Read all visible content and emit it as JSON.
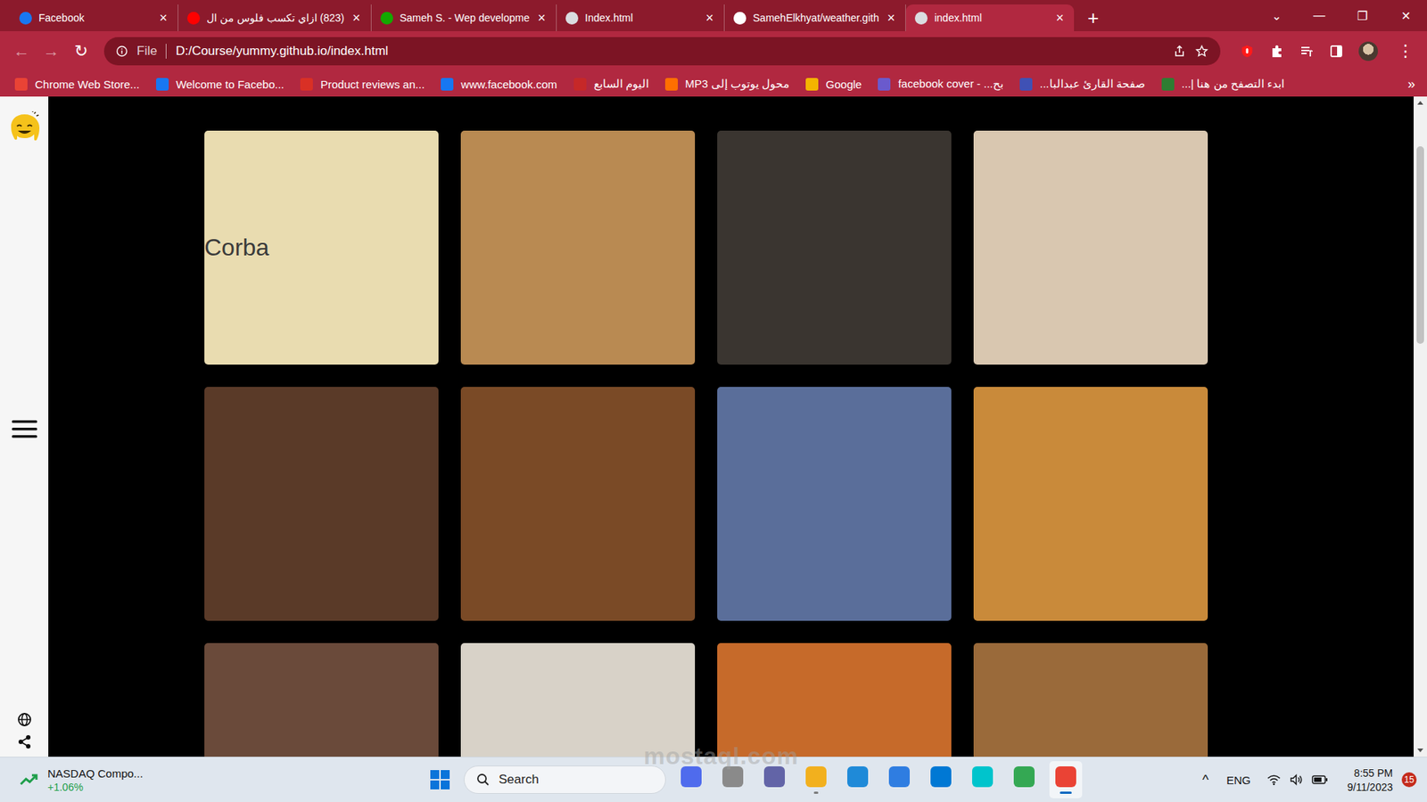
{
  "tabs": [
    {
      "label": "Facebook",
      "selected": false,
      "color": "#1877f2",
      "close": "×"
    },
    {
      "label": "(823) ازاي تكسب فلوس من ال",
      "selected": false,
      "color": "#ff0000",
      "close": "×"
    },
    {
      "label": "Sameh S. - Wep developme",
      "selected": false,
      "color": "#14a800",
      "close": "×"
    },
    {
      "label": "Index.html",
      "selected": false,
      "color": "#dadce0",
      "close": "×"
    },
    {
      "label": "SamehElkhyat/weather.gith",
      "selected": false,
      "color": "#ffffff",
      "close": "×"
    },
    {
      "label": "index.html",
      "selected": true,
      "color": "#dadce0",
      "close": "×"
    }
  ],
  "tab_strip": {
    "new_tab": "+",
    "tab_search": "⌄",
    "controls": [
      "—",
      "❐",
      "✕"
    ]
  },
  "toolbar": {
    "back": "←",
    "forward": "→",
    "reload": "↻",
    "scheme": "File",
    "address": "D:/Course/yummy.github.io/index.html",
    "menu": "⋮"
  },
  "bookmarks": {
    "items": [
      {
        "label": "Chrome Web Store...",
        "color": "#ea4335"
      },
      {
        "label": "Welcome to Facebo...",
        "color": "#1877f2"
      },
      {
        "label": "Product reviews an...",
        "color": "#d93025"
      },
      {
        "label": "www.facebook.com",
        "color": "#1877f2"
      },
      {
        "label": "اليوم السابع",
        "color": "#c62828"
      },
      {
        "label": "محول يوتوب إلى MP3",
        "color": "#ff6f00"
      },
      {
        "label": "Google",
        "color": "#f4b400"
      },
      {
        "label": "facebook cover - ...بح",
        "color": "#6a5acd"
      },
      {
        "label": "صفحة القارئ عبدالبا...",
        "color": "#3f51b5"
      },
      {
        "label": "ابدء التصفح من هنا |...",
        "color": "#2e7d32"
      }
    ],
    "more": "»"
  },
  "gallery": [
    {
      "caption": "Corba",
      "color": "#e9dcb0"
    },
    {
      "caption": "",
      "color": "#b98a52"
    },
    {
      "caption": "",
      "color": "#3a3530"
    },
    {
      "caption": "",
      "color": "#d9c7b0"
    },
    {
      "caption": "",
      "color": "#5a3a28"
    },
    {
      "caption": "",
      "color": "#7a4a26"
    },
    {
      "caption": "",
      "color": "#5a6e9a"
    },
    {
      "caption": "",
      "color": "#c98a3a"
    },
    {
      "caption": "",
      "color": "#6a4a3a"
    },
    {
      "caption": "",
      "color": "#d8d2c8"
    },
    {
      "caption": "",
      "color": "#c66a2a"
    },
    {
      "caption": "",
      "color": "#9a6a3a"
    }
  ],
  "taskbar": {
    "widget": {
      "title": "NASDAQ Compo...",
      "change": "+1.06%",
      "color": "#1e9e4a"
    },
    "search": "Search",
    "apps": [
      {
        "color": "#4f6bed",
        "running": false,
        "selected": false
      },
      {
        "color": "#8a8a8a",
        "running": false,
        "selected": false
      },
      {
        "color": "#6264a7",
        "running": false,
        "selected": false
      },
      {
        "color": "#f2b01e",
        "running": true,
        "selected": false
      },
      {
        "color": "#1f8ad8",
        "running": false,
        "selected": false
      },
      {
        "color": "#2f7de1",
        "running": false,
        "selected": false
      },
      {
        "color": "#0078d4",
        "running": false,
        "selected": false
      },
      {
        "color": "#00c4cc",
        "running": false,
        "selected": false
      },
      {
        "color": "#34a853",
        "running": false,
        "selected": false
      },
      {
        "color": "#ea4335",
        "running": true,
        "selected": true
      }
    ],
    "chevron": "^",
    "language": "ENG",
    "time": "8:55 PM",
    "date": "9/11/2023",
    "badge": "15"
  },
  "watermark": "mostaql.com"
}
